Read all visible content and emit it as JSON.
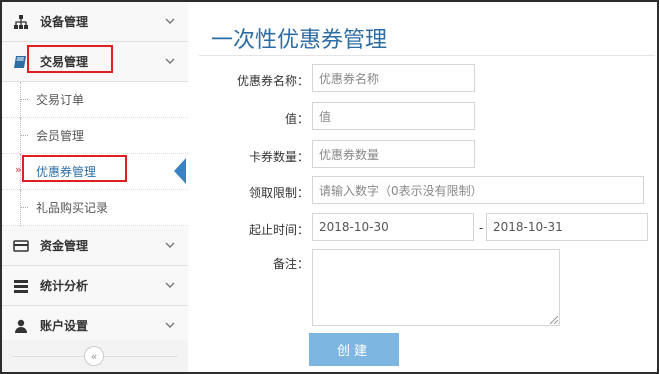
{
  "sidebar": {
    "groups": [
      {
        "label": "设备管理",
        "icon": "sitemap-icon"
      },
      {
        "label": "交易管理",
        "icon": "book-icon"
      },
      {
        "label": "资金管理",
        "icon": "credit-card-icon"
      },
      {
        "label": "统计分析",
        "icon": "server-icon"
      },
      {
        "label": "账户设置",
        "icon": "user-icon"
      }
    ],
    "sub_items": [
      {
        "label": "交易订单"
      },
      {
        "label": "会员管理"
      },
      {
        "label": "优惠券管理"
      },
      {
        "label": "礼品购买记录"
      }
    ],
    "collapse_label": "«",
    "current_marker": "»"
  },
  "page": {
    "title": "一次性优惠券管理"
  },
  "form": {
    "name_label": "优惠券名称：",
    "name_placeholder": "优惠券名称",
    "value_label": "值：",
    "value_placeholder": "值",
    "count_label": "卡券数量：",
    "count_placeholder": "优惠券数量",
    "limit_label": "领取限制：",
    "limit_placeholder": "请输入数字（0表示没有限制）",
    "period_label": "起止时间：",
    "start_date": "2018-10-30",
    "range_separator": "-",
    "end_date": "2018-10-31",
    "remark_label": "备注：",
    "remark_value": "",
    "submit_label": "创建"
  },
  "colors": {
    "accent": "#2e6da4",
    "button": "#7eb6e2",
    "highlight": "#e02020"
  }
}
